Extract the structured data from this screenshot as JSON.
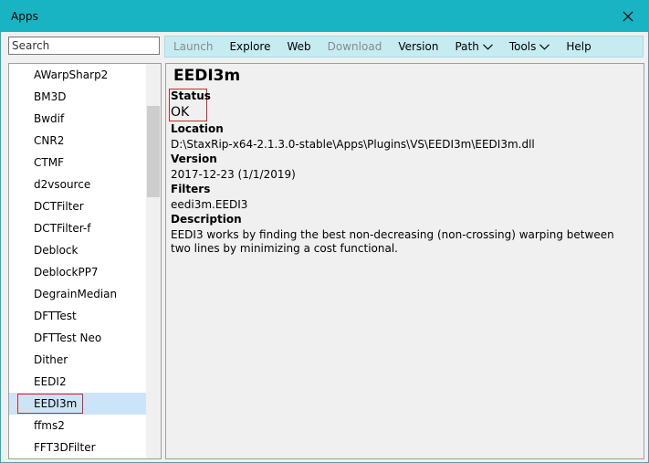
{
  "window": {
    "title": "Apps",
    "accent": "#19b4c4"
  },
  "search": {
    "placeholder": "Search",
    "value": ""
  },
  "menu": [
    {
      "label": "Launch",
      "disabled": true,
      "dropdown": false
    },
    {
      "label": "Explore",
      "disabled": false,
      "dropdown": false
    },
    {
      "label": "Web",
      "disabled": false,
      "dropdown": false
    },
    {
      "label": "Download",
      "disabled": true,
      "dropdown": false
    },
    {
      "label": "Version",
      "disabled": false,
      "dropdown": false
    },
    {
      "label": "Path",
      "disabled": false,
      "dropdown": true
    },
    {
      "label": "Tools",
      "disabled": false,
      "dropdown": true
    },
    {
      "label": "Help",
      "disabled": false,
      "dropdown": false
    }
  ],
  "sidebar": {
    "items": [
      "AWarpSharp2",
      "BM3D",
      "Bwdif",
      "CNR2",
      "CTMF",
      "d2vsource",
      "DCTFilter",
      "DCTFilter-f",
      "Deblock",
      "DeblockPP7",
      "DegrainMedian",
      "DFTTest",
      "DFTTest Neo",
      "Dither",
      "EEDI2",
      "EEDI3m",
      "ffms2",
      "FFT3DFilter"
    ],
    "selected": "EEDI3m"
  },
  "detail": {
    "title": "EEDI3m",
    "status_label": "Status",
    "status_value": "OK",
    "location_label": "Location",
    "location_value": "D:\\StaxRip-x64-2.1.3.0-stable\\Apps\\Plugins\\VS\\EEDI3m\\EEDI3m.dll",
    "version_label": "Version",
    "version_value": "2017-12-23 (1/1/2019)",
    "filters_label": "Filters",
    "filters_value": "eedi3m.EEDI3",
    "description_label": "Description",
    "description_value": "EEDI3 works by finding the best non-decreasing (non-crossing) warping between two lines by minimizing a cost functional."
  }
}
